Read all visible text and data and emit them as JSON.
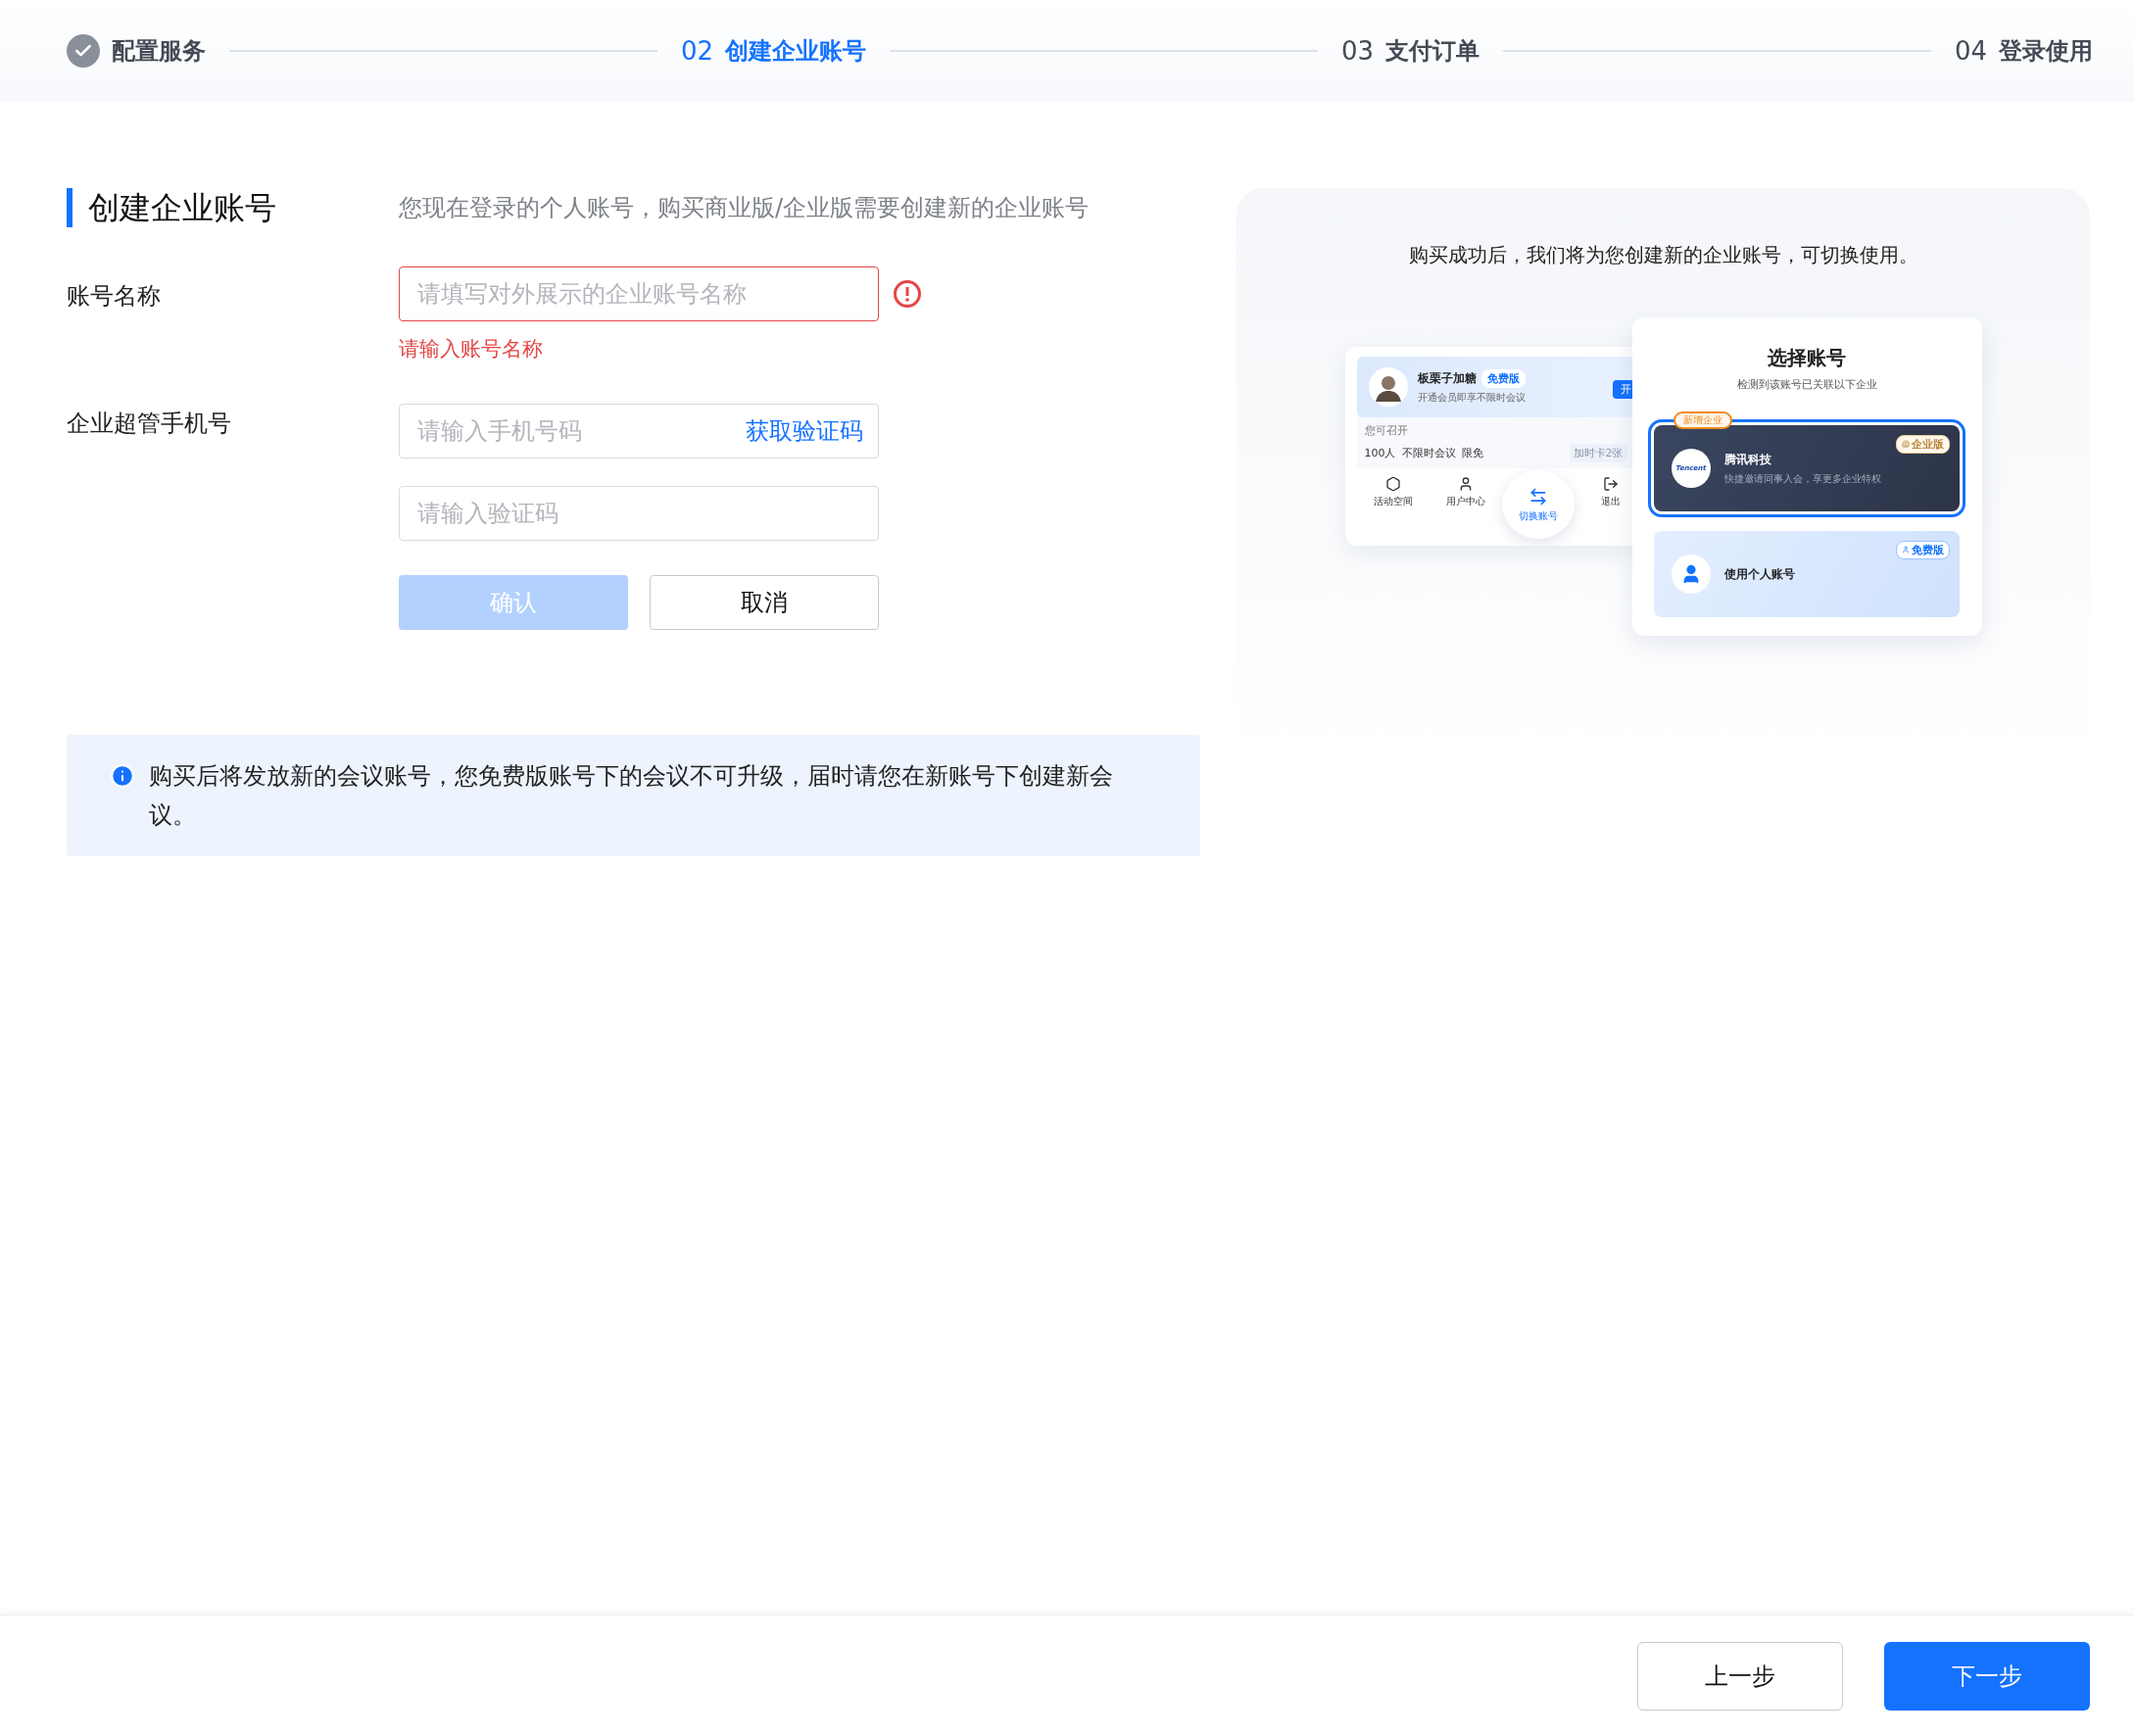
{
  "steps": [
    {
      "label": "配置服务",
      "done": true,
      "selected": false
    },
    {
      "number": "02",
      "label": "创建企业账号",
      "done": false,
      "selected": true
    },
    {
      "number": "03",
      "label": "支付订单",
      "done": false,
      "selected": false
    },
    {
      "number": "04",
      "label": "登录使用",
      "done": false,
      "selected": false
    }
  ],
  "form": {
    "title": "创建企业账号",
    "notice": "您现在登录的个人账号，购买商业版/企业版需要创建新的企业账号",
    "fields": [
      {
        "kind": "text",
        "label": "账号名称",
        "placeholder": "请填写对外展示的企业账号名称",
        "error": "请输入账号名称"
      },
      {
        "kind": "phone",
        "label": "企业超管手机号",
        "placeholder": "请输入手机号码",
        "action": "获取验证码"
      },
      {
        "kind": "code",
        "placeholder": "请输入验证码"
      }
    ],
    "buttons": [
      {
        "kind": "primary",
        "label": "确认",
        "disabled": true
      },
      {
        "kind": "default",
        "label": "取消",
        "disabled": false
      }
    ]
  },
  "info": "购买后将发放新的会议账号，您免费版账号下的会议不可升级，届时请您在新账号下创建新会议。",
  "preview": {
    "caption": "购买成功后，我们将为您创建新的企业账号，可切换使用。",
    "profile_card": {
      "name": "板栗子加糖",
      "badge": "免费版",
      "subtitle": "开通会员即享不限时会议",
      "open_button": "开",
      "section_title": "您可召开",
      "features": [
        "100人",
        "不限时会议",
        "限免"
      ],
      "extra": "加时卡2张",
      "nav": [
        {
          "kind": "space",
          "label": "活动空间",
          "selected": false
        },
        {
          "kind": "user",
          "label": "用户中心",
          "selected": false
        },
        {
          "kind": "switch",
          "label": "切换账号",
          "selected": true
        },
        {
          "kind": "logout",
          "label": "退出",
          "selected": false
        }
      ]
    },
    "account_picker": {
      "title": "选择账号",
      "subtitle": "检测到该账号已关联以下企业",
      "accounts": [
        {
          "kind": "enterprise",
          "tag": "新增企业",
          "logo": "Tencent",
          "name": "腾讯科技",
          "description": "快捷邀请同事入会，享更多企业特权",
          "badge": "企业版",
          "selected": true
        },
        {
          "kind": "personal",
          "name": "使用个人账号",
          "badge": "免费版",
          "selected": false
        }
      ]
    }
  },
  "footer": {
    "buttons": [
      {
        "kind": "default",
        "label": "上一步"
      },
      {
        "kind": "primary",
        "label": "下一步"
      }
    ]
  }
}
